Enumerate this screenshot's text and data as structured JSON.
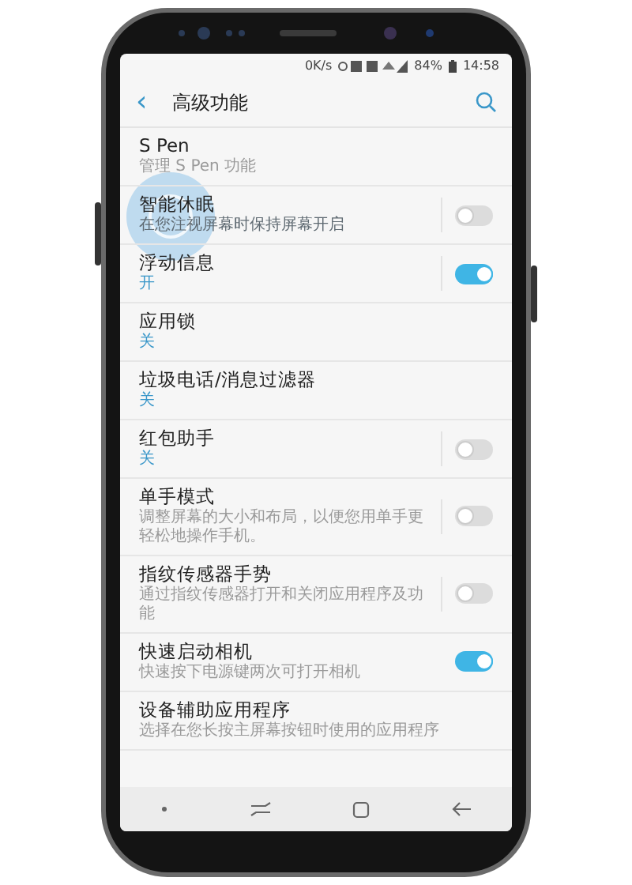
{
  "status_bar": {
    "speed": "0K/s",
    "battery": "84%",
    "time": "14:58"
  },
  "app_bar": {
    "back": "‹",
    "title": "高级功能"
  },
  "items": [
    {
      "kind": "text",
      "title": "S Pen",
      "description": "管理 S Pen 功能"
    },
    {
      "kind": "split-switch",
      "title": "智能休眠",
      "description": "在您注视屏幕时保持屏幕开启",
      "on": false,
      "touched": true
    },
    {
      "kind": "split-switch",
      "title": "浮动信息",
      "value": "开",
      "on": true
    },
    {
      "kind": "text",
      "title": "应用锁",
      "value": "关"
    },
    {
      "kind": "text",
      "title": "垃圾电话/消息过滤器",
      "value": "关"
    },
    {
      "kind": "split-switch",
      "title": "红包助手",
      "value": "关",
      "on": false
    },
    {
      "kind": "split-switch",
      "title": "单手模式",
      "description": "调整屏幕的大小和布局，以便您用单手更轻松地操作手机。",
      "on": false
    },
    {
      "kind": "split-switch",
      "title": "指纹传感器手势",
      "description": "通过指纹传感器打开和关闭应用程序及功能",
      "on": false
    },
    {
      "kind": "switch",
      "title": "快速启动相机",
      "description": "快速按下电源键两次可打开相机",
      "on": true
    },
    {
      "kind": "text",
      "title": "设备辅助应用程序",
      "description": "选择在您长按主屏幕按钮时使用的应用程序"
    }
  ]
}
